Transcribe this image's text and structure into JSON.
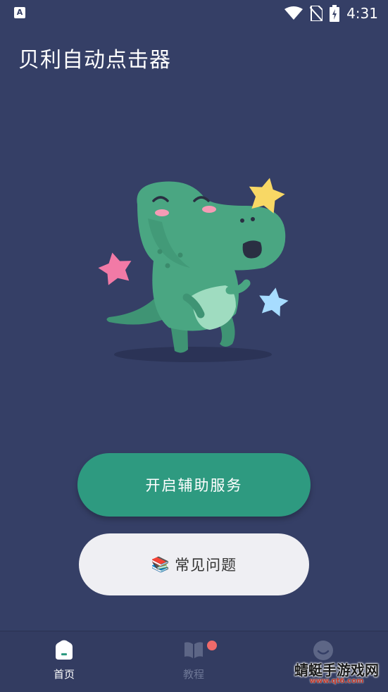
{
  "status_bar": {
    "time": "4:31",
    "notification_icon": "a-letter-icon",
    "icons": [
      "wifi-icon",
      "no-sim-icon",
      "battery-charging-icon"
    ]
  },
  "app": {
    "title": "贝利自动点击器"
  },
  "illustration": {
    "name": "dinosaur-mascot"
  },
  "actions": {
    "enable_service_label": "开启辅助服务",
    "faq_emoji": "📚",
    "faq_label": "常见问题"
  },
  "bottom_nav": {
    "items": [
      {
        "label": "首页",
        "icon": "home-icon",
        "active": true
      },
      {
        "label": "教程",
        "icon": "book-icon",
        "active": false,
        "badge": true
      },
      {
        "label": "",
        "icon": "smiley-icon",
        "active": false
      }
    ]
  },
  "watermark": {
    "text": "蜻蜓手游戏网",
    "url": "www.qt6.com"
  },
  "colors": {
    "background": "#353f66",
    "primary_button": "#2e9a80",
    "secondary_button": "#efeff3",
    "badge": "#ef6a6a"
  }
}
